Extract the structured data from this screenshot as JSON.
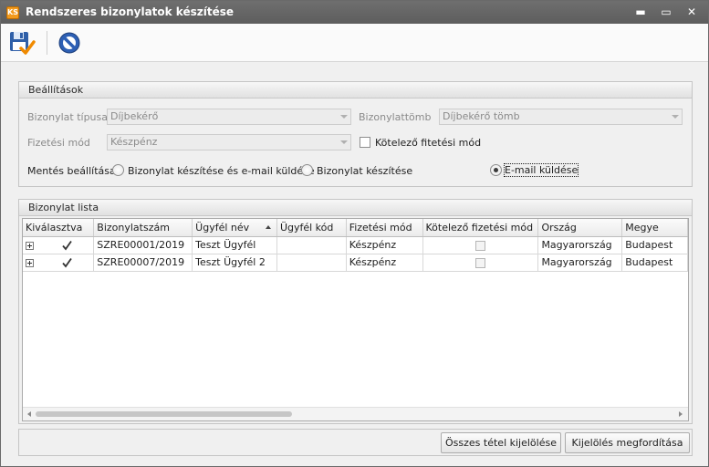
{
  "window": {
    "app_icon_text": "KS",
    "title": "Rendszeres bizonylatok készítése",
    "minimize": "▬",
    "maximize": "▭",
    "close": "✕"
  },
  "toolbar": {
    "save_icon": "save-check-icon",
    "cancel_icon": "cancel-icon"
  },
  "settings": {
    "header": "Beállítások",
    "doc_type_label": "Bizonylat típusa",
    "doc_type_value": "Díjbekérő",
    "doc_block_label": "Bizonylattömb",
    "doc_block_value": "Díjbekérő tömb",
    "payment_label": "Fizetési mód",
    "payment_value": "Készpénz",
    "mandatory_payment_label": "Kötelező fitetési mód",
    "mandatory_payment_checked": false,
    "save_setting_label": "Mentés beállítása",
    "radio_options": [
      {
        "label": "Bizonylat készítése és e-mail küldése",
        "selected": false
      },
      {
        "label": "Bizonylat készítése",
        "selected": false
      },
      {
        "label": "E-mail küldése",
        "selected": true
      }
    ]
  },
  "list": {
    "header": "Bizonylat lista",
    "columns": [
      "Kiválasztva",
      "Bizonylatszám",
      "Ügyfél név",
      "Ügyfél kód",
      "Fizetési mód",
      "Kötelező fizetési mód",
      "Ország",
      "Megye"
    ],
    "sorted_column": "Ügyfél név",
    "rows": [
      {
        "selected": true,
        "number": "SZRE00001/2019",
        "client_name": "Teszt Ügyfél",
        "client_code": "",
        "payment": "Készpénz",
        "mandatory": false,
        "country": "Magyarország",
        "county": "Budapest"
      },
      {
        "selected": true,
        "number": "SZRE00007/2019",
        "client_name": "Teszt Ügyfél 2",
        "client_code": "",
        "payment": "Készpénz",
        "mandatory": false,
        "country": "Magyarország",
        "county": "Budapest"
      }
    ]
  },
  "footer": {
    "select_all_label": "Összes tétel kijelölése",
    "invert_selection_label": "Kijelölés megfordítása"
  }
}
